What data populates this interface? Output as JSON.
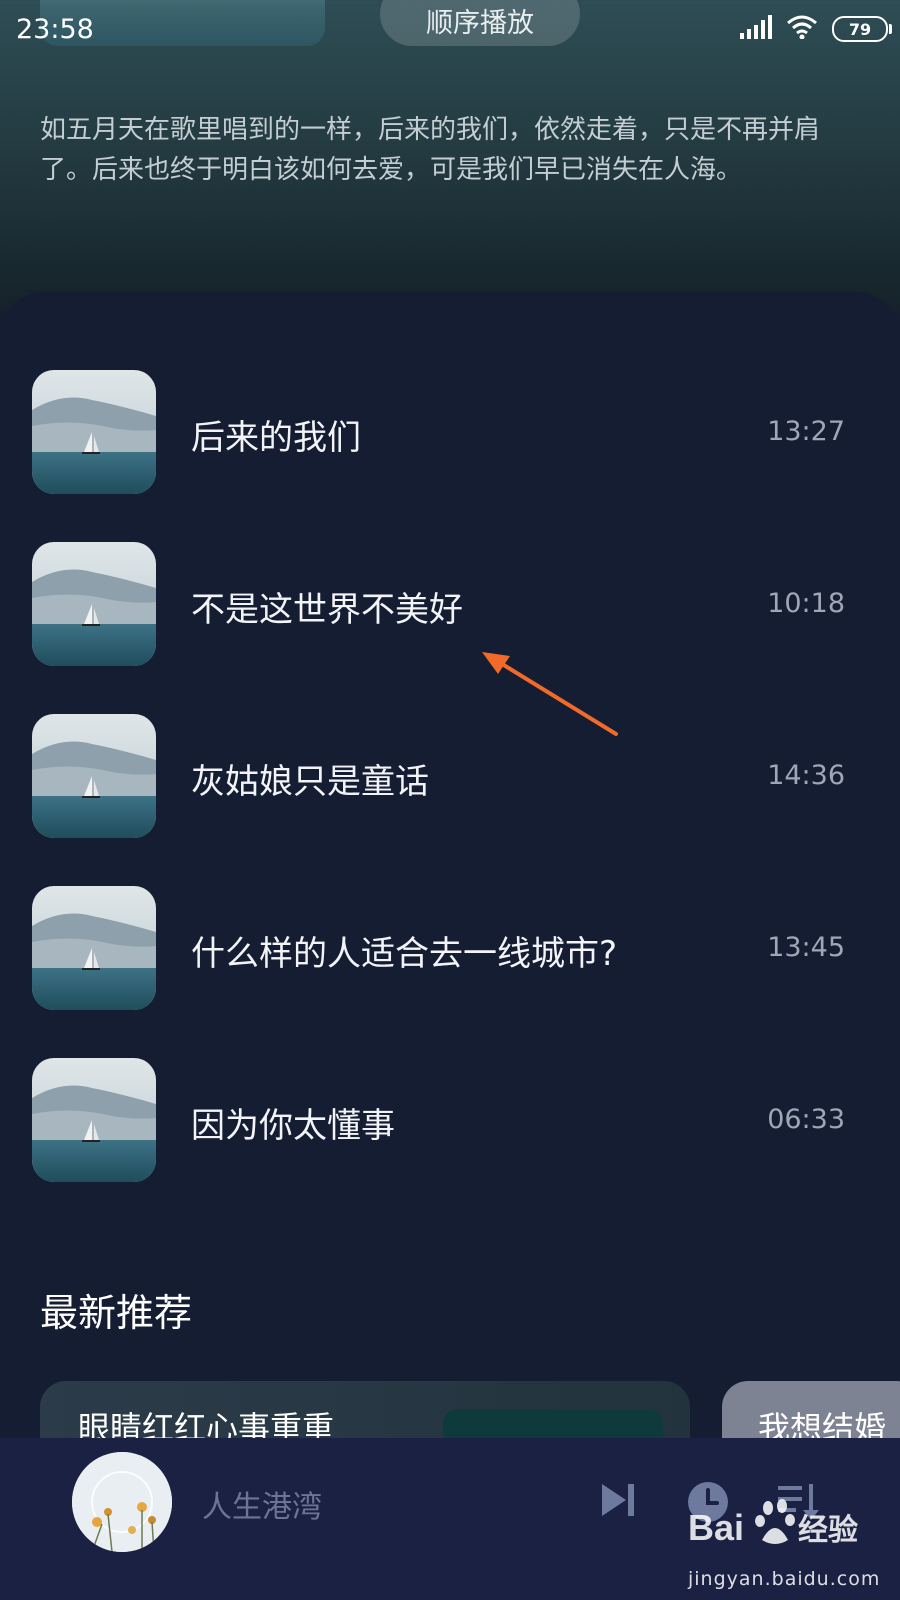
{
  "status": {
    "time": "23:58",
    "battery": "79"
  },
  "header": {
    "play_order_label": "顺序播放"
  },
  "description": "如五月天在歌里唱到的一样，后来的我们，依然走着，只是不再并肩了。后来也终于明白该如何去爱，可是我们早已消失在人海。",
  "tracks": [
    {
      "title": "后来的我们",
      "duration": "13:27"
    },
    {
      "title": "不是这世界不美好",
      "duration": "10:18"
    },
    {
      "title": "灰姑娘只是童话",
      "duration": "14:36"
    },
    {
      "title": "什么样的人适合去一线城市?",
      "duration": "13:45"
    },
    {
      "title": "因为你太懂事",
      "duration": "06:33"
    }
  ],
  "recommend": {
    "title": "最新推荐",
    "cards": [
      {
        "text": "眼睛红红心事重重"
      },
      {
        "text": "我想结婚"
      }
    ]
  },
  "player": {
    "now_playing": "人生港湾"
  },
  "watermark": {
    "brand": "Bai经验",
    "url": "jingyan.baidu.com"
  },
  "colors": {
    "background": "#151d33",
    "player_bar": "#1a2142",
    "arrow": "#f26a2a",
    "muted_text": "#9fa6b6"
  }
}
